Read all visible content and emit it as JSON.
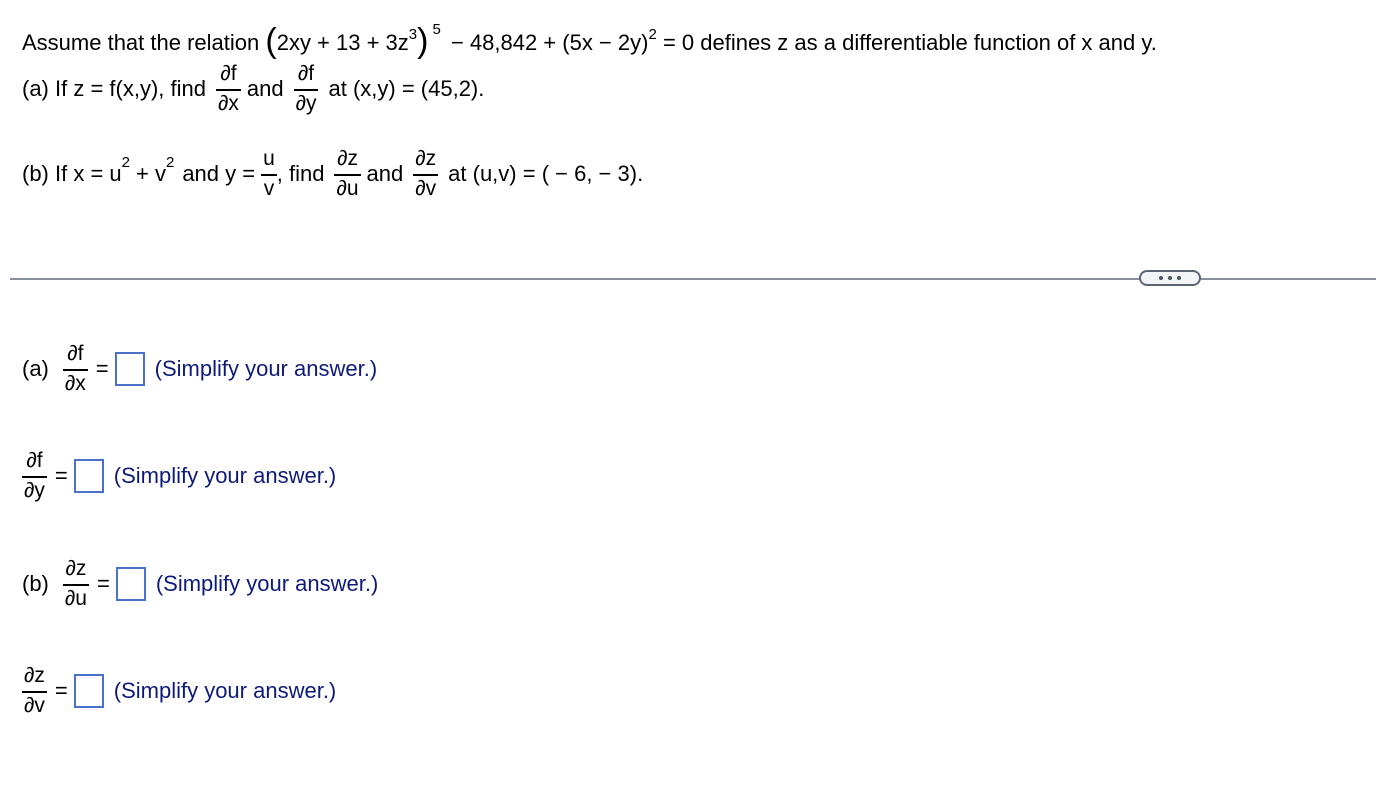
{
  "problem": {
    "intro": {
      "prefix": "Assume that the relation",
      "inner": "2xy + 13 + 3z",
      "inner_exp": "3",
      "outer_exp": "5",
      "middle": "− 48,842 + (5x − 2y)",
      "middle_exp": "2",
      "suffix": "= 0 defines z as a differentiable function of x and y."
    },
    "part_a": {
      "prefix": "(a) If z = f(x,y), find",
      "frac1": {
        "num": "∂f",
        "den": "∂x"
      },
      "and": "and",
      "frac2": {
        "num": "∂f",
        "den": "∂y"
      },
      "suffix": "at (x,y) = (45,2)."
    },
    "part_b": {
      "prefix": "(b) If x = u",
      "u_exp": "2",
      "plus_v": "+ v",
      "v_exp": "2",
      "and_y": "and y =",
      "frac_y": {
        "num": "u",
        "den": "v"
      },
      "find": ", find",
      "frac1": {
        "num": "∂z",
        "den": "∂u"
      },
      "and": "and",
      "frac2": {
        "num": "∂z",
        "den": "∂v"
      },
      "suffix": "at (u,v) = ( − 6, − 3)."
    }
  },
  "divider": {
    "more_button_icon": "ellipsis-icon"
  },
  "answers": [
    {
      "label": "(a)",
      "num": "∂f",
      "den": "∂x",
      "equals": "=",
      "value": "",
      "hint": "(Simplify your answer.)"
    },
    {
      "label": "",
      "num": "∂f",
      "den": "∂y",
      "equals": "=",
      "value": "",
      "hint": "(Simplify your answer.)"
    },
    {
      "label": "(b)",
      "num": "∂z",
      "den": "∂u",
      "equals": "=",
      "value": "",
      "hint": "(Simplify your answer.)"
    },
    {
      "label": "",
      "num": "∂z",
      "den": "∂v",
      "equals": "=",
      "value": "",
      "hint": "(Simplify your answer.)"
    }
  ],
  "colors": {
    "hint_text": "#0e1a7a",
    "answer_box_border": "#4a72c8",
    "divider": "#8a909c"
  }
}
